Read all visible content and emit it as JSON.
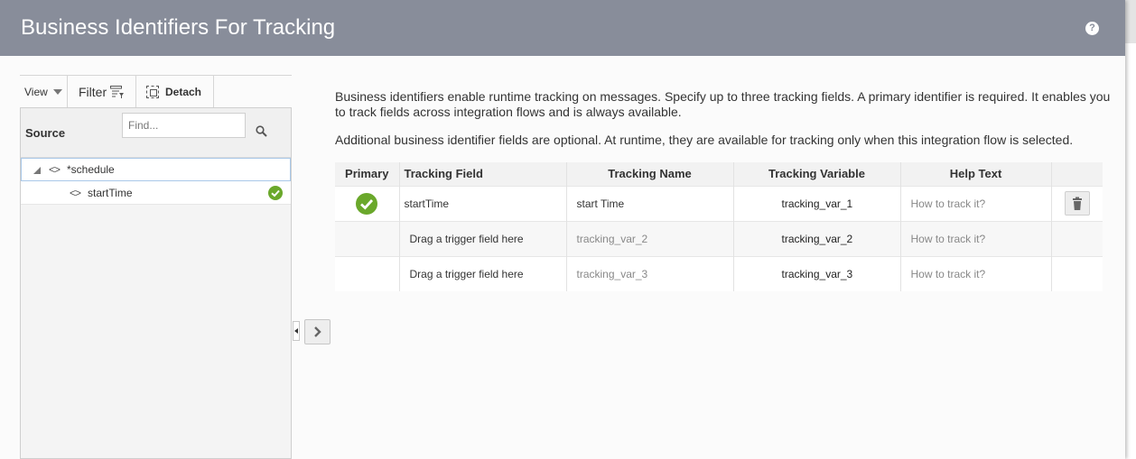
{
  "dialog": {
    "title": "Business Identifiers For Tracking",
    "help_icon": "help-icon",
    "help_glyph": "?"
  },
  "source_panel": {
    "toolbar": {
      "view_label": "View",
      "filter_label": "Filter",
      "detach_label": "Detach"
    },
    "source_label": "Source",
    "search_placeholder": "Find...",
    "tree": [
      {
        "label": "*schedule",
        "icon": "element-icon",
        "expanded": true
      },
      {
        "label": "startTime",
        "icon": "element-icon",
        "status_icon": "checkmark-icon"
      }
    ]
  },
  "description": {
    "line1": "Business identifiers enable runtime tracking on messages. Specify up to three tracking fields. A primary identifier is required. It enables you to track fields across integration flows and is always available.",
    "line2": "Additional business identifier fields are optional. At runtime, they are available for tracking only when this integration flow is selected."
  },
  "tracking_table": {
    "columns": {
      "primary": "Primary",
      "field": "Tracking Field",
      "name": "Tracking Name",
      "variable": "Tracking Variable",
      "help": "Help Text"
    },
    "rows": [
      {
        "primary": true,
        "field": "startTime",
        "name": "start Time",
        "variable": "tracking_var_1",
        "help": "How to track it?",
        "delete_icon": "trash-icon"
      },
      {
        "primary": false,
        "field": "Drag a trigger field here",
        "name": "tracking_var_2",
        "variable": "tracking_var_2",
        "help": "How to track it?"
      },
      {
        "primary": false,
        "field": "Drag a trigger field here",
        "name": "tracking_var_3",
        "variable": "tracking_var_3",
        "help": "How to track it?"
      }
    ]
  },
  "colors": {
    "header_bg": "#888d9a",
    "check_green": "#6aa82b",
    "panel_bg": "#f4f4f4"
  }
}
